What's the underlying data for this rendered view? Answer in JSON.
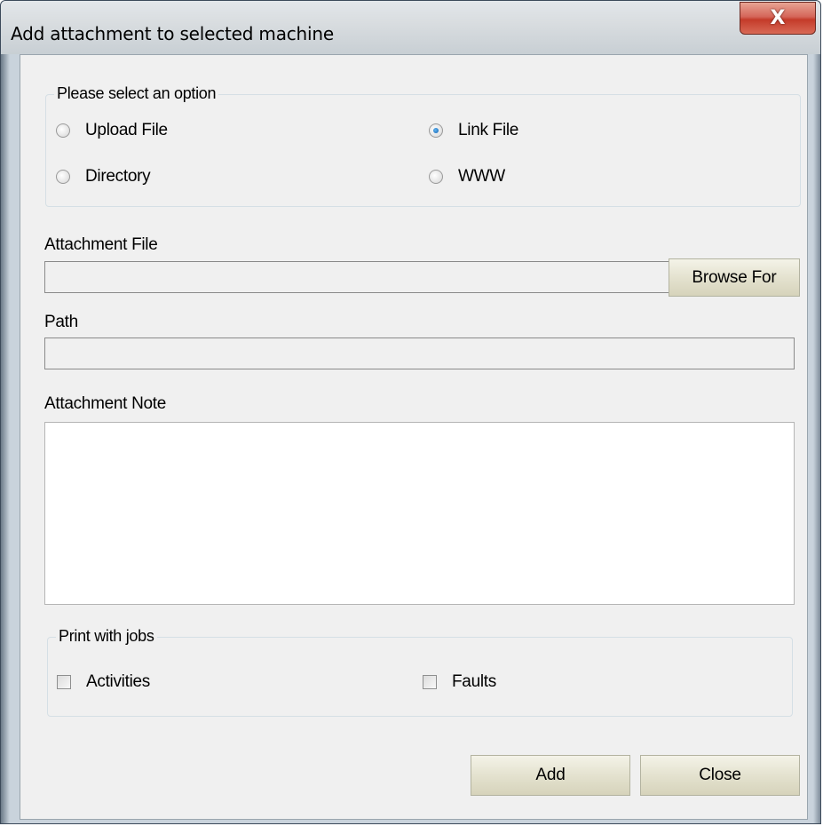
{
  "window": {
    "title": "Add attachment to selected machine",
    "close_glyph": "X"
  },
  "option_group": {
    "legend": "Please select an option",
    "options": [
      {
        "label": "Upload File",
        "checked": false
      },
      {
        "label": "Link File",
        "checked": true
      },
      {
        "label": "Directory",
        "checked": false
      },
      {
        "label": "WWW",
        "checked": false
      }
    ]
  },
  "attachment_file": {
    "label": "Attachment File",
    "value": "",
    "browse_label": "Browse For"
  },
  "path": {
    "label": "Path",
    "value": ""
  },
  "note": {
    "label": "Attachment Note",
    "value": ""
  },
  "print_group": {
    "legend": "Print with jobs",
    "items": [
      {
        "label": "Activities",
        "checked": false
      },
      {
        "label": "Faults",
        "checked": false
      }
    ]
  },
  "footer": {
    "add_label": "Add",
    "close_label": "Close"
  },
  "colors": {
    "title_bar": "#d9dde0",
    "client_bg": "#f0f0f0",
    "close_button": "#c43b2a",
    "radio_selected": "#1462b0"
  }
}
